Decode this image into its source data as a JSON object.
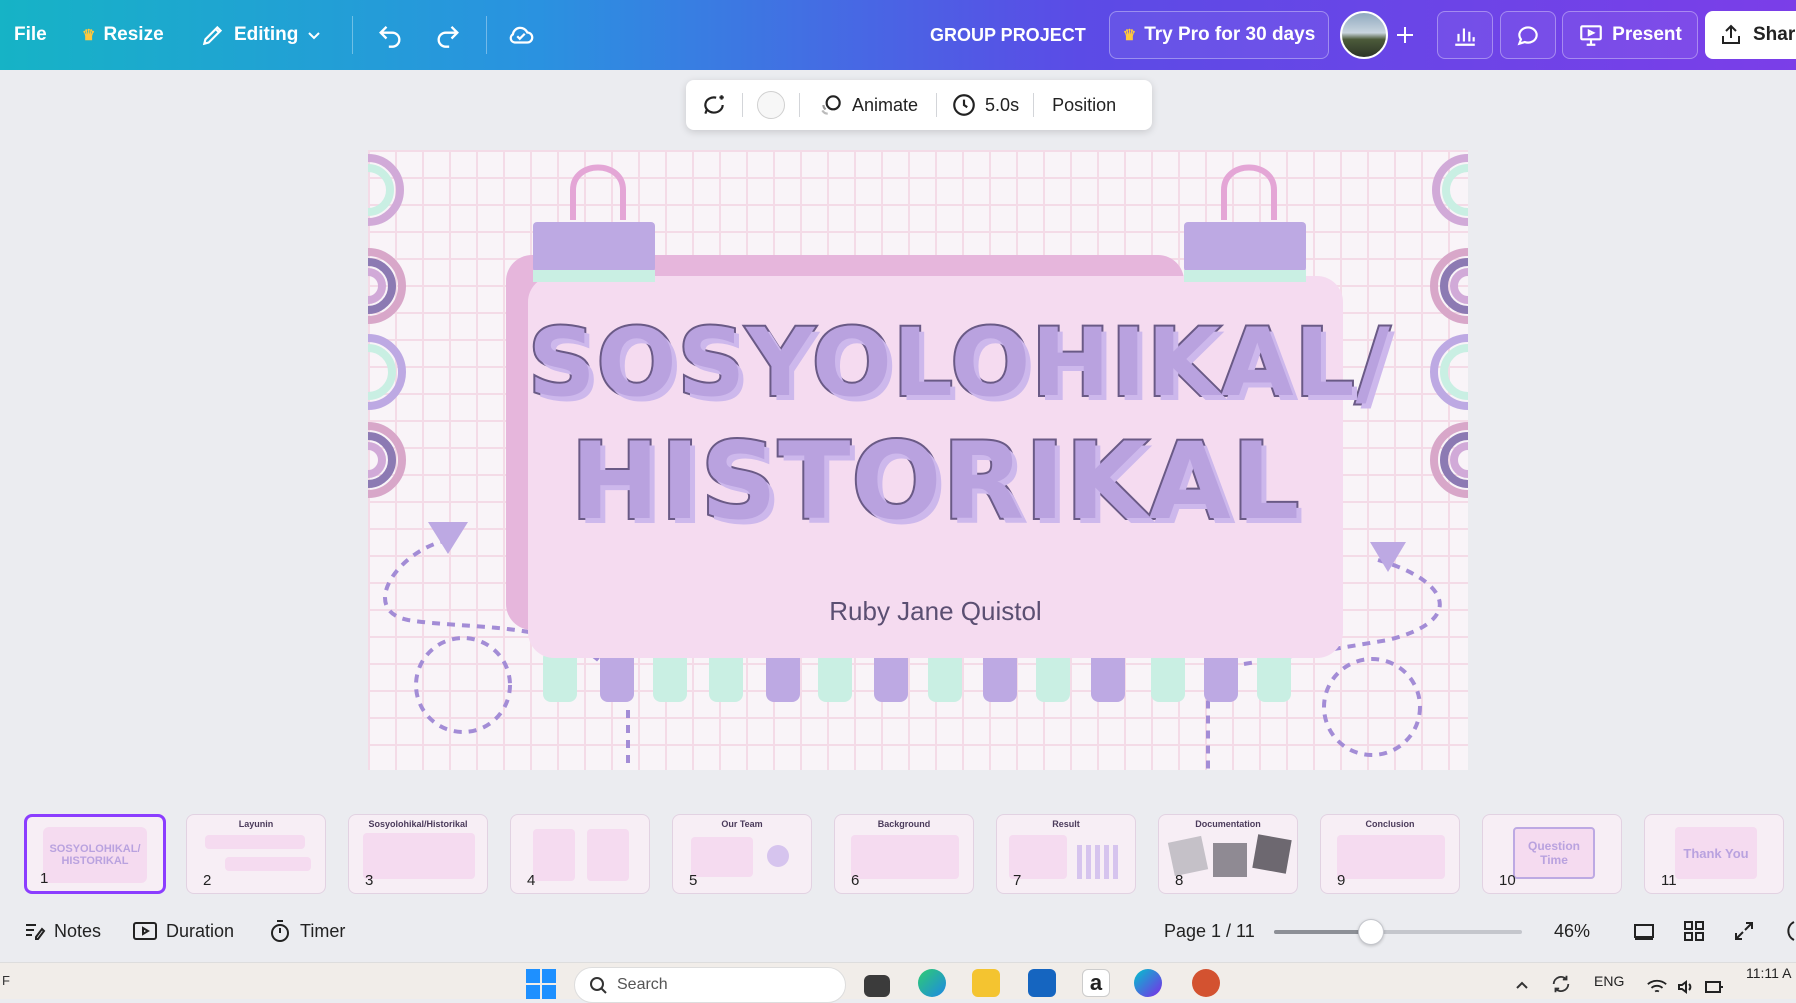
{
  "topbar": {
    "file_label": "File",
    "resize_label": "Resize",
    "editing_label": "Editing",
    "project_title": "GROUP PROJECT",
    "try_pro_label": "Try Pro for 30 days",
    "present_label": "Present",
    "share_label": "Share"
  },
  "floating_toolbar": {
    "animate_label": "Animate",
    "duration_label": "5.0s",
    "position_label": "Position"
  },
  "slide": {
    "title_line1": "SOSYOLOHIKAL/",
    "title_line2": "HISTORIKAL",
    "author": "Ruby Jane Quistol"
  },
  "thumbnails": [
    {
      "number": "1",
      "title": "",
      "selected": true
    },
    {
      "number": "2",
      "title": "Layunin"
    },
    {
      "number": "3",
      "title": "Sosyolohikal/Historikal"
    },
    {
      "number": "4",
      "title": ""
    },
    {
      "number": "5",
      "title": "Our Team"
    },
    {
      "number": "6",
      "title": "Background"
    },
    {
      "number": "7",
      "title": "Result"
    },
    {
      "number": "8",
      "title": "Documentation"
    },
    {
      "number": "9",
      "title": "Conclusion"
    },
    {
      "number": "10",
      "title": "Question Time"
    },
    {
      "number": "11",
      "title": "Thank You"
    }
  ],
  "bottombar": {
    "notes_label": "Notes",
    "duration_label": "Duration",
    "timer_label": "Timer",
    "page_indicator": "Page 1 / 11",
    "zoom_value": 46,
    "zoom_label": "46%"
  },
  "taskbar": {
    "search_placeholder": "Search",
    "language": "ENG",
    "time": "11:11 A"
  },
  "colors": {
    "accent": "#8b3dff",
    "title_fill": "#b9a2df",
    "title_outline": "#6a5a86",
    "card": "#f5dbf0",
    "clip": "#bda9e3",
    "mint": "#c9efe3"
  }
}
